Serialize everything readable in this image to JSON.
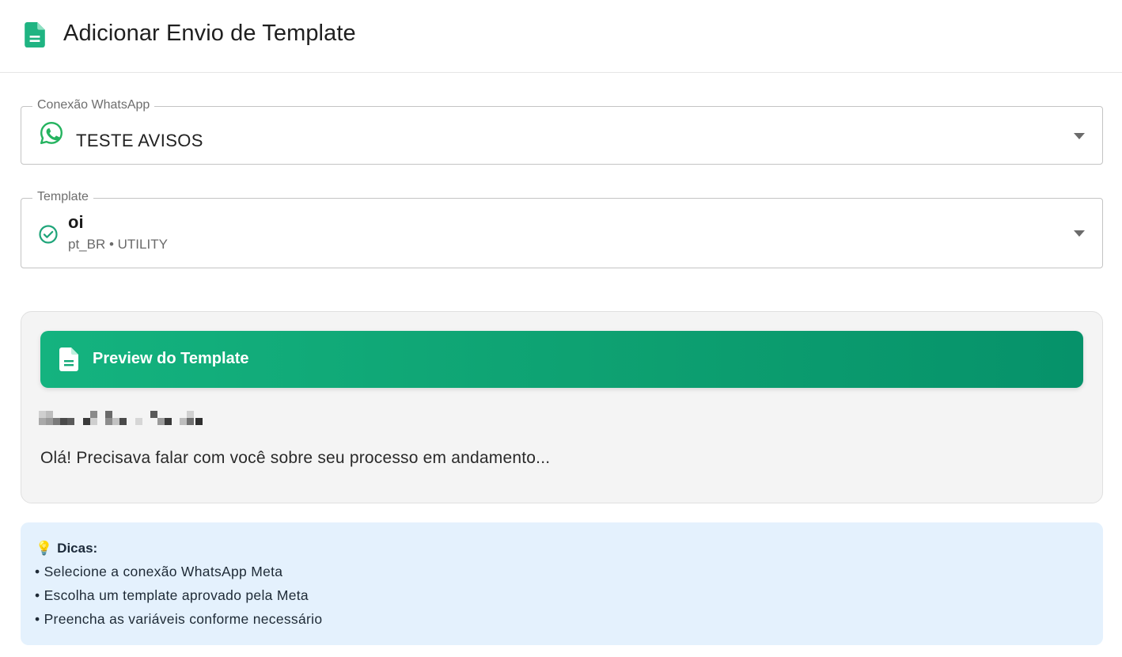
{
  "header": {
    "title": "Adicionar Envio de Template",
    "icon": "document-icon"
  },
  "connection_field": {
    "label": "Conexão WhatsApp",
    "value": "TESTE AVISOS",
    "icon": "whatsapp-icon"
  },
  "template_field": {
    "label": "Template",
    "name": "oi",
    "meta": "pt_BR • UTILITY",
    "icon": "check-circle-icon"
  },
  "preview": {
    "title": "Preview do Template",
    "body": "Olá! Precisava falar com você sobre seu processo em andamento..."
  },
  "tips": {
    "icon": "💡",
    "title": "Dicas:",
    "items": [
      "• Selecione a conexão WhatsApp Meta",
      "• Escolha um template aprovado pela Meta",
      "• Preencha as variáveis conforme necessário"
    ]
  },
  "colors": {
    "accent": "#12a877",
    "tips_bg": "#e4f1fd",
    "preview_bg": "#f4f4f4"
  }
}
